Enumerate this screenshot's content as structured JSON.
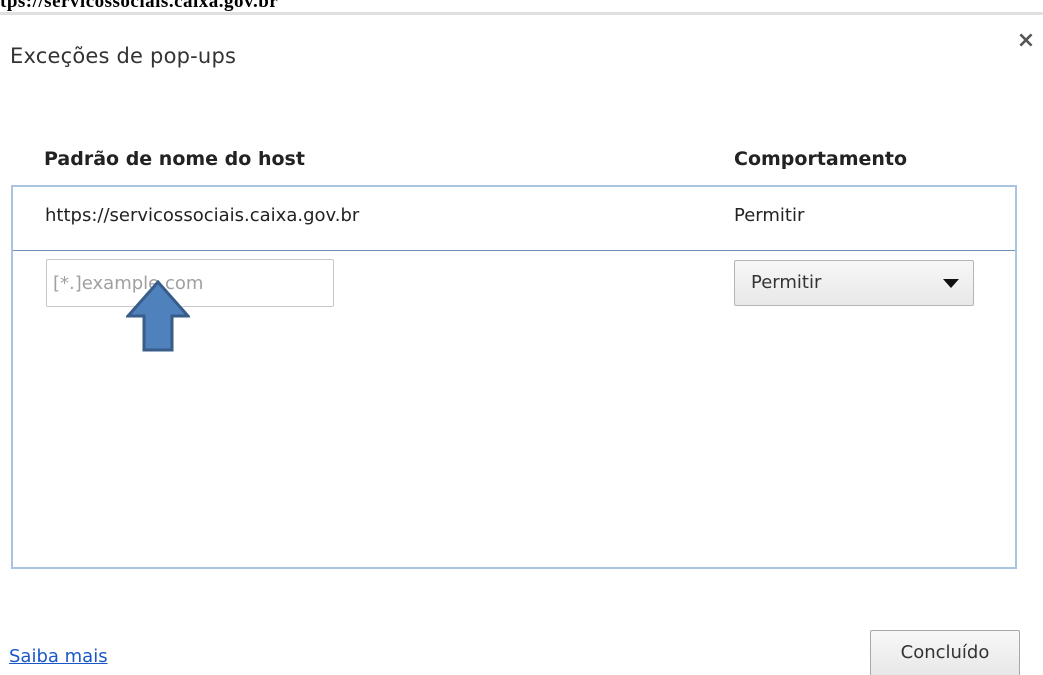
{
  "page_header": {
    "url_text": "tps://servicossociais.caixa.gov.br"
  },
  "dialog": {
    "title": "Exceções de pop-ups",
    "close_icon": "close-icon",
    "close_glyph": "×"
  },
  "table": {
    "columns": [
      "Padrão de nome do host",
      "Comportamento"
    ],
    "rows": [
      {
        "host": "https://servicossociais.caixa.gov.br",
        "behavior": "Permitir"
      }
    ],
    "new_entry": {
      "host_placeholder": "[*.]example.com",
      "host_value": "",
      "behavior_selected": "Permitir"
    }
  },
  "annotation": {
    "arrow_icon": "up-arrow-icon",
    "arrow_fill": "#4f81bd",
    "arrow_stroke": "#385d8a"
  },
  "footer": {
    "learn_more": "Saiba mais",
    "done_label": "Concluído"
  },
  "colors": {
    "list_border": "#a9c4e2",
    "link": "#1a57c9"
  }
}
